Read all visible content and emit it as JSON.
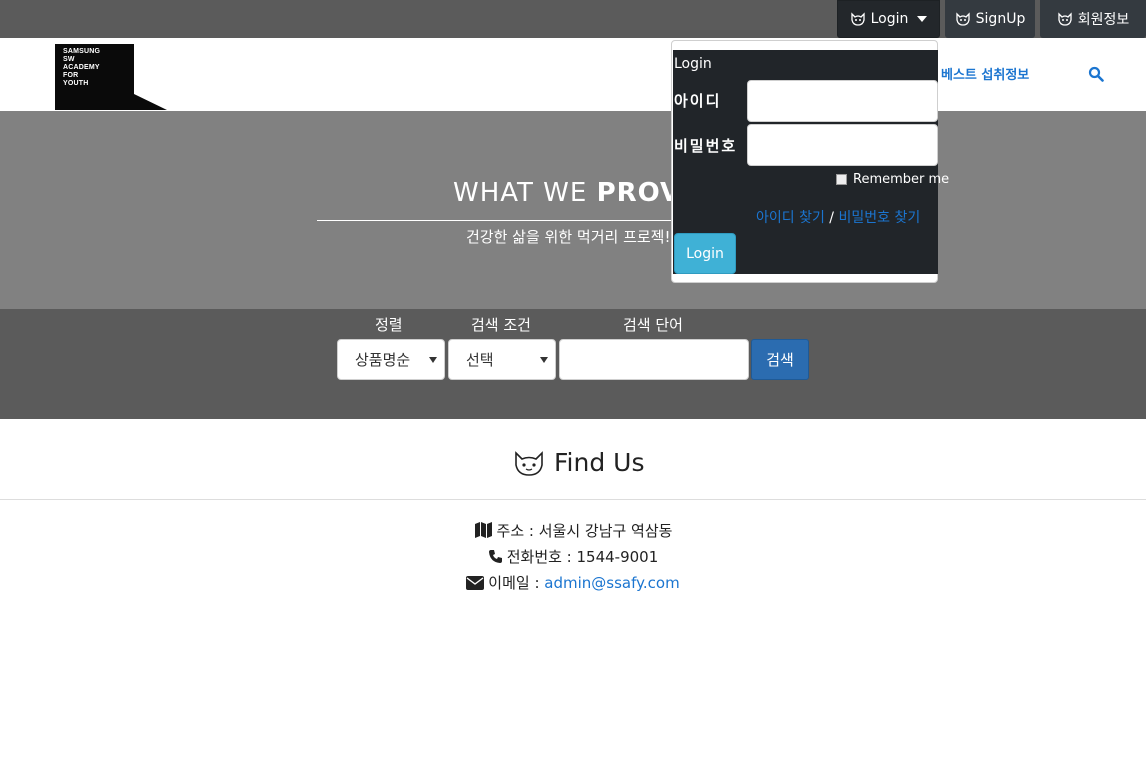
{
  "topbar": {
    "login_label": "Login",
    "signup_label": "SignUp",
    "member_label": "회원정보",
    "icon": "cat-face-icon"
  },
  "header": {
    "logo_text": "SAMSUNG\nSW\nACADEMY\nFOR\nYOUTH",
    "nav_best": "베스트 섭취정보",
    "search_icon": "search-icon"
  },
  "hero": {
    "title_light": "WHAT WE ",
    "title_bold": "PROVID",
    "subtitle": "건강한 삶을 위한 먹거리 프로젝!"
  },
  "search": {
    "sort_label": "정렬",
    "cond_label": "검색 조건",
    "word_label": "검색 단어",
    "sort_value": "상품명순",
    "cond_value": "선택",
    "word_value": "",
    "button_label": "검색"
  },
  "findus": {
    "title": "Find Us",
    "address": "주소 : 서울시 강남구 역삼동",
    "phone": "전화번호 : 1544-9001",
    "email_label": "이메일 : ",
    "email": "admin@ssafy.com"
  },
  "login_dropdown": {
    "title": "Login",
    "id_label": "아이디",
    "pw_label": "비밀번호",
    "remember_label": "Remember me",
    "find_id": "아이디 찾기",
    "separator": " / ",
    "find_pw": "비밀번호 찾기",
    "button_label": "Login"
  },
  "colors": {
    "topbar": "#5b5b5b",
    "hero": "#818181",
    "accent_blue": "#1b75d0",
    "login_button": "#3fb1d6"
  }
}
